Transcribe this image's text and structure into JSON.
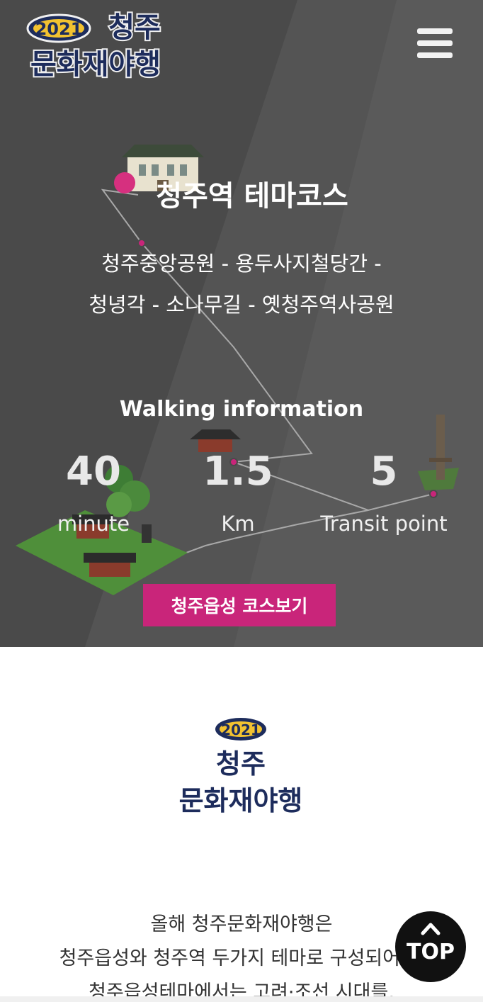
{
  "header": {
    "logo_year": "2021",
    "logo_line1": "청주",
    "logo_line2": "문화재야행",
    "menu_icon": "hamburger-menu-icon"
  },
  "course": {
    "title": "청주역 테마코스",
    "route_line1": "청주중앙공원 - 용두사지철당간 -",
    "route_line2": "청녕각 - 소나무길 - 옛청주역사공원"
  },
  "walking": {
    "title": "Walking information",
    "stats": [
      {
        "value": "40",
        "unit": "minute"
      },
      {
        "value": "1.5",
        "unit": "Km"
      },
      {
        "value": "5",
        "unit": "Transit point"
      }
    ]
  },
  "course_button": {
    "label": "청주읍성 코스보기"
  },
  "intro": {
    "logo_year": "2021",
    "logo_line1": "청주",
    "logo_line2": "문화재야행",
    "text_line1": "올해 청주문화재야행은",
    "text_line2": "청주읍성와 청주역 두가지 테마로 구성되어 있",
    "text_line3": "청주읍성테마에서는 고려·조선 시대를,"
  },
  "top_button": {
    "label": "TOP",
    "icon": "chevron-up-icon"
  },
  "colors": {
    "hero_bg": "#4a4a4a",
    "accent": "#c9257a",
    "logo_navy": "#1d2c5c",
    "logo_gold": "#f2c230"
  }
}
